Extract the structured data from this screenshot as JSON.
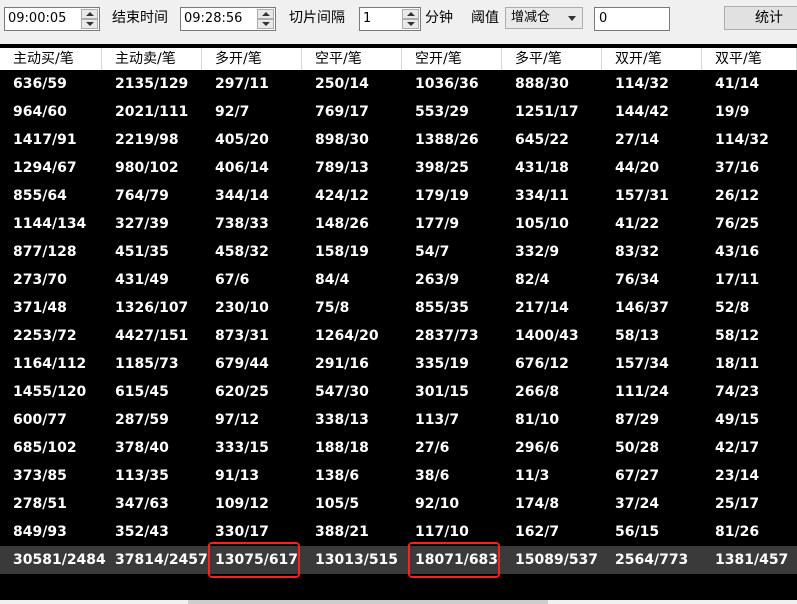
{
  "toolbar": {
    "start_time": "09:00:05",
    "end_label": "结束时间",
    "end_time": "09:28:56",
    "interval_label": "切片间隔",
    "interval_value": "1",
    "interval_unit": "分钟",
    "threshold_label": "阈值",
    "threshold_mode": "增减仓",
    "threshold_value": "0",
    "stats_button": "统计"
  },
  "table": {
    "headers": [
      "主动买/笔",
      "主动卖/笔",
      "多开/笔",
      "空平/笔",
      "空开/笔",
      "多平/笔",
      "双开/笔",
      "双平/笔"
    ],
    "rows": [
      [
        "636/59",
        "2135/129",
        "297/11",
        "250/14",
        "1036/36",
        "888/30",
        "114/32",
        "41/14"
      ],
      [
        "964/60",
        "2021/111",
        "92/7",
        "769/17",
        "553/29",
        "1251/17",
        "144/42",
        "19/9"
      ],
      [
        "1417/91",
        "2219/98",
        "405/20",
        "898/30",
        "1388/26",
        "645/22",
        "27/14",
        "114/32"
      ],
      [
        "1294/67",
        "980/102",
        "406/14",
        "789/13",
        "398/25",
        "431/18",
        "44/20",
        "37/16"
      ],
      [
        "855/64",
        "764/79",
        "344/14",
        "424/12",
        "179/19",
        "334/11",
        "157/31",
        "26/12"
      ],
      [
        "1144/134",
        "327/39",
        "738/33",
        "148/26",
        "177/9",
        "105/10",
        "41/22",
        "76/25"
      ],
      [
        "877/128",
        "451/35",
        "458/32",
        "158/19",
        "54/7",
        "332/9",
        "83/32",
        "43/16"
      ],
      [
        "273/70",
        "431/49",
        "67/6",
        "84/4",
        "263/9",
        "82/4",
        "76/34",
        "17/11"
      ],
      [
        "371/48",
        "1326/107",
        "230/10",
        "75/8",
        "855/35",
        "217/14",
        "146/37",
        "52/8"
      ],
      [
        "2253/72",
        "4427/151",
        "873/31",
        "1264/20",
        "2837/73",
        "1400/43",
        "58/13",
        "58/12"
      ],
      [
        "1164/112",
        "1185/73",
        "679/44",
        "291/16",
        "335/19",
        "676/12",
        "157/34",
        "18/11"
      ],
      [
        "1455/120",
        "615/45",
        "620/25",
        "547/30",
        "301/15",
        "266/8",
        "111/24",
        "74/23"
      ],
      [
        "600/77",
        "287/59",
        "97/12",
        "338/13",
        "113/7",
        "81/10",
        "87/29",
        "49/15"
      ],
      [
        "685/102",
        "378/40",
        "333/15",
        "188/18",
        "27/6",
        "296/6",
        "50/28",
        "42/17"
      ],
      [
        "373/85",
        "113/35",
        "91/13",
        "138/6",
        "38/6",
        "11/3",
        "67/27",
        "23/14"
      ],
      [
        "278/51",
        "347/63",
        "109/12",
        "105/5",
        "92/10",
        "174/8",
        "37/24",
        "25/17"
      ],
      [
        "849/93",
        "352/43",
        "330/17",
        "388/21",
        "117/10",
        "162/7",
        "56/15",
        "81/26"
      ]
    ],
    "totals": [
      "30581/2484",
      "37814/2457",
      "13075/617",
      "13013/515",
      "18071/683",
      "15089/537",
      "2564/773",
      "1381/457"
    ],
    "highlighted_total_columns": [
      2,
      4
    ],
    "highlight_color": "#ff2020"
  }
}
